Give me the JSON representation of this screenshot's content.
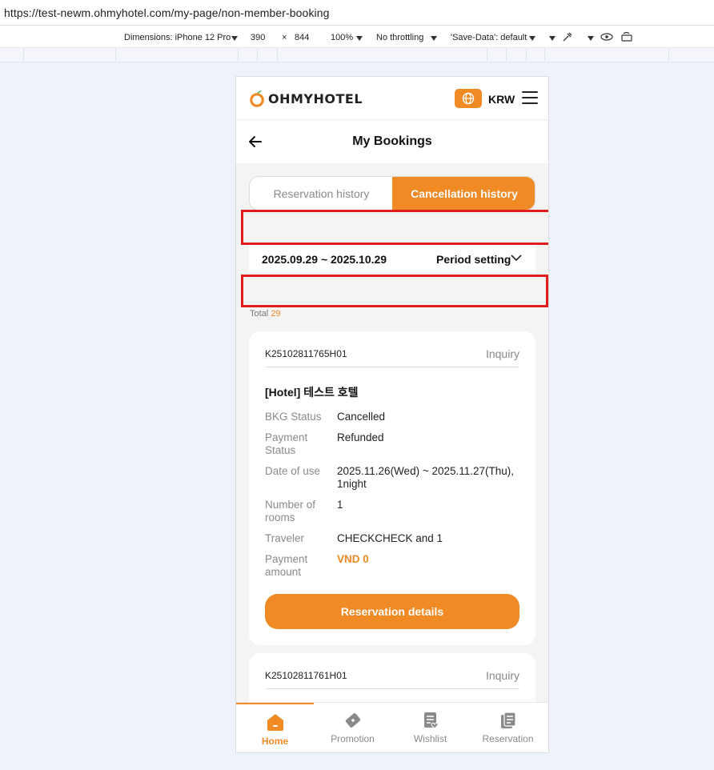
{
  "browser": {
    "url": "https://test-newm.ohmyhotel.com/my-page/non-member-booking"
  },
  "devtools": {
    "dimensions_label": "Dimensions: iPhone 12 Pro",
    "width": "390",
    "times": "×",
    "height": "844",
    "zoom": "100%",
    "throttling": "No throttling",
    "save_data": "'Save-Data': default"
  },
  "header": {
    "logo_text": "OHMYHOTEL",
    "currency": "KRW"
  },
  "titlebar": {
    "title": "My Bookings"
  },
  "tabs": [
    {
      "label": "Reservation history",
      "active": false
    },
    {
      "label": "Cancellation history",
      "active": true
    }
  ],
  "period": {
    "range": "2025.09.29 ~ 2025.10.29",
    "setting_label": "Period setting"
  },
  "total": {
    "label": "Total",
    "count": "29"
  },
  "bookings": [
    {
      "code": "K25102811765H01",
      "inquiry_label": "Inquiry",
      "hotel_name": "[Hotel] 테스트 호텔",
      "rows": [
        {
          "label": "BKG Status",
          "value": "Cancelled"
        },
        {
          "label": "Payment Status",
          "value": "Refunded"
        },
        {
          "label": "Date of use",
          "value": "2025.11.26(Wed) ~ 2025.11.27(Thu), 1night"
        },
        {
          "label": "Number of rooms",
          "value": "1"
        },
        {
          "label": "Traveler",
          "value": "CHECKCHECK and 1"
        },
        {
          "label": "Payment amount",
          "value": "VND 0"
        }
      ],
      "details_button": "Reservation details"
    },
    {
      "code": "K25102811761H01",
      "inquiry_label": "Inquiry"
    }
  ],
  "bottom_nav": [
    {
      "label": "Home",
      "icon": "home-icon",
      "active": true
    },
    {
      "label": "Promotion",
      "icon": "ticket-icon",
      "active": false
    },
    {
      "label": "Wishlist",
      "icon": "wishlist-icon",
      "active": false
    },
    {
      "label": "Reservation",
      "icon": "reservation-icon",
      "active": false
    }
  ],
  "colors": {
    "accent": "#f08a24",
    "highlight_box": "#e21c1c"
  }
}
